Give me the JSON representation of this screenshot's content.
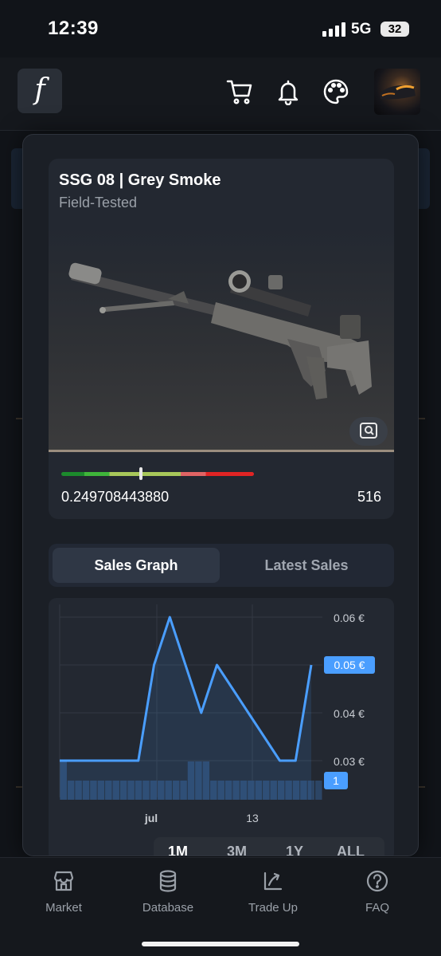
{
  "status_bar": {
    "time": "12:39",
    "network": "5G",
    "battery": "32"
  },
  "header": {
    "logo": "f",
    "icons": [
      "cart-icon",
      "bell-icon",
      "palette-icon"
    ],
    "avatar": "user-avatar"
  },
  "item": {
    "name": "SSG 08 | Grey Smoke",
    "wear": "Field-Tested",
    "float_value": "0.249708443880",
    "float_fraction": 0.4147,
    "pattern": "516",
    "inspect_icon": "inspect-icon"
  },
  "tabs": [
    {
      "label": "Sales Graph",
      "active": true
    },
    {
      "label": "Latest Sales",
      "active": false
    }
  ],
  "chart": {
    "range_tabs": [
      "1M",
      "3M",
      "1Y",
      "ALL"
    ],
    "selected_range": "1M",
    "current_price_label": "0.05 €",
    "current_volume_label": "1",
    "accent": "#4a9eff"
  },
  "chart_data": {
    "type": "line",
    "x_tick_labels": [
      "jul",
      "13"
    ],
    "y_tick_labels": [
      "0.06 €",
      "0.05 €",
      "0.04 €",
      "0.03 €"
    ],
    "ylim": [
      0.03,
      0.06
    ],
    "series": [
      {
        "values": [
          0.03,
          0.03,
          0.03,
          0.03,
          0.03,
          0.03,
          0.05,
          0.06,
          0.05,
          0.04,
          0.05,
          0.045,
          0.04,
          0.035,
          0.03,
          0.03,
          0.05
        ]
      }
    ],
    "volume": [
      2,
      1,
      1,
      1,
      1,
      1,
      1,
      1,
      1,
      1,
      1,
      1,
      1,
      1,
      1,
      1,
      1,
      2,
      2,
      2,
      1,
      1,
      1,
      1,
      1,
      1,
      1,
      1,
      1,
      1,
      1,
      1,
      1,
      1,
      1
    ]
  },
  "nav": [
    {
      "label": "Market",
      "icon": "store-icon"
    },
    {
      "label": "Database",
      "icon": "database-icon"
    },
    {
      "label": "Trade Up",
      "icon": "trade-up-icon"
    },
    {
      "label": "FAQ",
      "icon": "help-icon"
    }
  ]
}
